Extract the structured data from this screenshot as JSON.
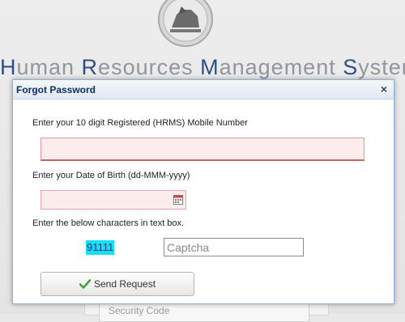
{
  "app": {
    "title_parts": [
      {
        "cap": "H",
        "rest": "uman "
      },
      {
        "cap": "R",
        "rest": "esources "
      },
      {
        "cap": "M",
        "rest": "anagement "
      },
      {
        "cap": "S",
        "rest": "ystem"
      }
    ]
  },
  "background": {
    "security_code_label": "Security Code"
  },
  "dialog": {
    "title": "Forgot Password",
    "close_label": "×",
    "mobile_label": "Enter your 10 digit Registered (HRMS) Mobile Number",
    "mobile_value": "",
    "dob_label": "Enter your Date of Birth (dd-MMM-yyyy)",
    "dob_value": "",
    "captcha_label": "Enter the below characters in text box.",
    "captcha_code": "91111",
    "captcha_placeholder": "Captcha",
    "send_button_label": "Send Request"
  },
  "colors": {
    "title_capital": "#2f4f8a",
    "title_rest": "#8f96a0",
    "dialog_title": "#0e2d5f",
    "invalid_field_bg": "#fdecec",
    "captcha_highlight": "#19e0f0",
    "check_icon": "#3aa53a"
  },
  "icons": {
    "emblem": "state-emblem-icon",
    "calendar": "calendar-icon",
    "check": "check-icon",
    "close": "close-icon"
  }
}
